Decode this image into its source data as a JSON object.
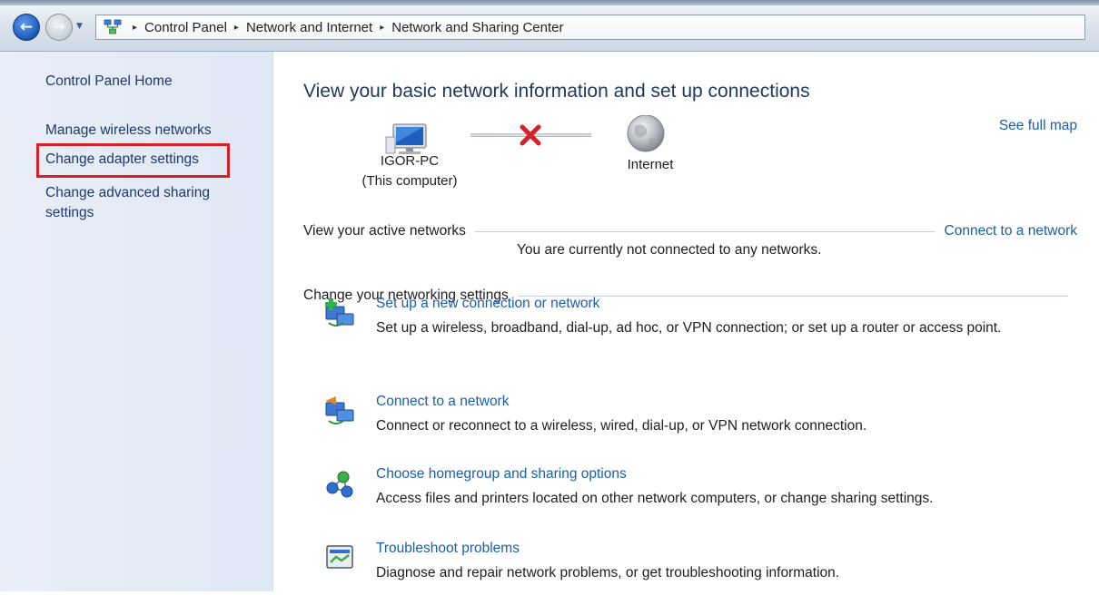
{
  "breadcrumb": {
    "items": [
      "Control Panel",
      "Network and Internet",
      "Network and Sharing Center"
    ],
    "separator": "▸"
  },
  "sidebar": {
    "items": [
      {
        "label": "Control Panel Home"
      },
      {
        "label": "Manage wireless networks"
      },
      {
        "label": "Change adapter settings",
        "highlighted": true
      },
      {
        "label": "Change advanced sharing settings"
      }
    ]
  },
  "main": {
    "title": "View your basic network information and set up connections",
    "see_full_map": "See full map",
    "map": {
      "computer_name": "IGOR-PC",
      "computer_sub": "(This computer)",
      "internet_label": "Internet",
      "status": "disconnected"
    },
    "active_networks": {
      "heading": "View your active networks",
      "link": "Connect to a network",
      "message": "You are currently not connected to any networks."
    },
    "change_settings": {
      "heading": "Change your networking settings",
      "tasks": [
        {
          "link": "Set up a new connection or network",
          "desc": "Set up a wireless, broadband, dial-up, ad hoc, or VPN connection; or set up a router or access point.",
          "icon": "new-connection-icon"
        },
        {
          "link": "Connect to a network",
          "desc": "Connect or reconnect to a wireless, wired, dial-up, or VPN network connection.",
          "icon": "connect-network-icon"
        },
        {
          "link": "Choose homegroup and sharing options",
          "desc": "Access files and printers located on other network computers, or change sharing settings.",
          "icon": "homegroup-icon"
        },
        {
          "link": "Troubleshoot problems",
          "desc": "Diagnose and repair network problems, or get troubleshooting information.",
          "icon": "troubleshoot-icon"
        }
      ]
    }
  },
  "colors": {
    "link": "#1a5fa8",
    "sidebar_link": "#1e3a6b",
    "title": "#1e395b",
    "highlight": "#d81f26",
    "sidebar_bg": "#e4ebf6",
    "error_x": "#d3202a"
  }
}
